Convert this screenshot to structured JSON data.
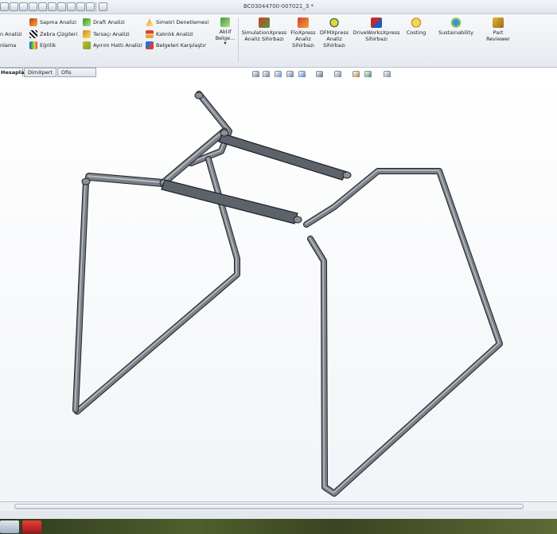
{
  "window": {
    "title": "BC03044700-007021_3 *"
  },
  "quick_access": [
    {
      "icon": "home-icon"
    },
    {
      "icon": "new-document-icon"
    },
    {
      "icon": "open-icon"
    },
    {
      "icon": "save-icon"
    },
    {
      "icon": "print-icon"
    },
    {
      "icon": "undo-icon"
    },
    {
      "icon": "rebuild-icon"
    },
    {
      "icon": "options-icon"
    },
    {
      "icon": "select-icon"
    },
    {
      "icon": "measure-icon"
    },
    {
      "icon": "help-icon"
    }
  ],
  "ribbon": {
    "col0": [
      "n Analizi",
      "nlama"
    ],
    "col1": [
      {
        "label": "Sapma Analizi",
        "icon": "draft-sweep-icon"
      },
      {
        "label": "Zebra Çizgileri",
        "icon": "zebra-stripes-icon"
      },
      {
        "label": "Eğrilik",
        "icon": "curvature-icon"
      }
    ],
    "col2": [
      {
        "label": "Draft Analizi",
        "icon": "draft-analysis-icon"
      },
      {
        "label": "Tersaçı Analizi",
        "icon": "undercut-icon"
      },
      {
        "label": "Ayırım Hattı Analizi",
        "icon": "parting-line-icon"
      }
    ],
    "col3": [
      {
        "label": "Simetri Denetlemesi",
        "icon": "symmetry-icon"
      },
      {
        "label": "Kalınlık Analizi",
        "icon": "thickness-icon"
      },
      {
        "label": "Belgeleri Karşılaştır",
        "icon": "compare-documents-icon"
      }
    ],
    "aktif": {
      "label": "Aktif\nBelge...",
      "icon": "active-document-icon"
    },
    "big_buttons": [
      {
        "label": "SimulationXpress\nAnaliz Sihirbazı",
        "icon": "simulationxpress-icon"
      },
      {
        "label": "FloXpress\nAnaliz\nSihirbazı",
        "icon": "floxpress-icon"
      },
      {
        "label": "DFMXpress\nAnaliz\nSihirbazı",
        "icon": "dfmxpress-icon"
      },
      {
        "label": "DriveWorksXpress\nSihirbazı",
        "icon": "driveworksxpress-icon"
      },
      {
        "label": "Costing",
        "icon": "costing-icon"
      },
      {
        "label": "Sustainability",
        "icon": "sustainability-icon"
      },
      {
        "label": "Part\nReviewer",
        "icon": "part-reviewer-icon"
      }
    ]
  },
  "tabs": [
    "Hesapla",
    "DimXpert",
    "Ofis Ürünleri"
  ],
  "colors": {
    "tube_fill": "#7b8088",
    "tube_edge": "#1e2226",
    "tube_highlight": "#b8bdc4",
    "accent": "#2d6fb7"
  }
}
